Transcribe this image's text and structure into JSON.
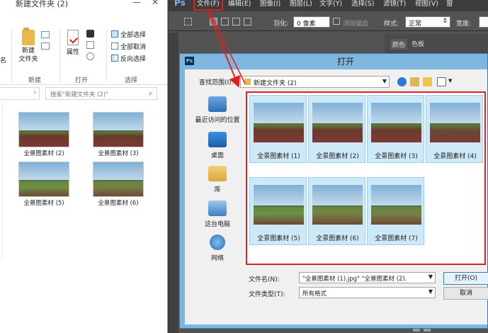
{
  "explorer": {
    "title": "新建文件夹 (2)",
    "win_buttons": {
      "minimize": "—",
      "close": "✕"
    },
    "ribbon": {
      "name_label": "名",
      "new_folder": "新建\n文件夹",
      "properties": "属性",
      "group_new": "新建",
      "group_open": "打开",
      "group_select": "选择",
      "select_all": "全部选择",
      "select_none": "全部取消",
      "invert_selection": "反向选择"
    },
    "address_chevron": "›",
    "search_placeholder": "搜索\"新建文件夹 (2)\"",
    "files": [
      {
        "label": "全景图素材 (2)"
      },
      {
        "label": "全景图素材 (3)"
      },
      {
        "label": "全景图素材 (5)"
      },
      {
        "label": "全景图素材 (6)"
      }
    ]
  },
  "photoshop": {
    "logo": "Ps",
    "menu": [
      "文件(F)",
      "编辑(E)",
      "图像(I)",
      "图层(L)",
      "文字(Y)",
      "选择(S)",
      "滤镜(T)",
      "视图(V)",
      "窗"
    ],
    "options": {
      "feather_label": "羽化:",
      "feather_value": "0 像素",
      "antialias_label": "消除锯齿",
      "style_label": "样式:",
      "style_value": "正常",
      "width_label": "宽度:"
    },
    "panel_tabs": [
      "颜色",
      "色板"
    ]
  },
  "open_dialog": {
    "title": "打开",
    "app_icon": "Ps",
    "look_in_label": "查找范围(I):",
    "look_in_value": "新建文件夹 (2)",
    "places": [
      {
        "label": "最近访问的位置"
      },
      {
        "label": "桌面"
      },
      {
        "label": "库"
      },
      {
        "label": "这台电脑"
      },
      {
        "label": "网络"
      }
    ],
    "files": [
      {
        "label": "全景图素材 (1)"
      },
      {
        "label": "全景图素材 (2)"
      },
      {
        "label": "全景图素材 (3)"
      },
      {
        "label": "全景图素材 (4)"
      },
      {
        "label": "全景图素材 (5)"
      },
      {
        "label": "全景图素材 (6)"
      },
      {
        "label": "全景图素材 (7)"
      }
    ],
    "filename_label": "文件名(N):",
    "filename_value": "\"全景图素材 (1).jpg\" \"全景图素材 (2).",
    "filetype_label": "文件类型(T):",
    "filetype_value": "所有格式",
    "open_button": "打开(O)",
    "cancel_button": "取消"
  },
  "colors": {
    "highlight_red": "#e02020",
    "dialog_frame": "#7fb6df",
    "selection_blue": "#cde8f7"
  }
}
